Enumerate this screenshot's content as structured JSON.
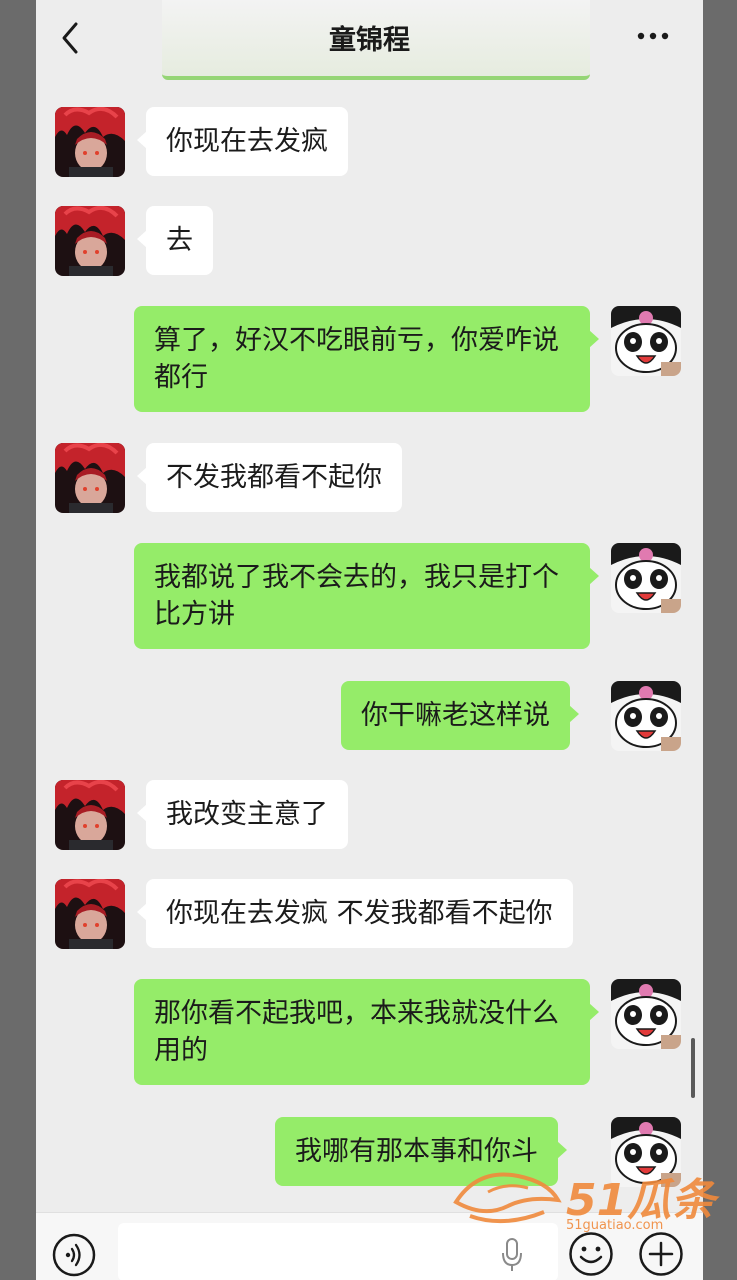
{
  "header": {
    "title": "童锦程",
    "back_icon": "chevron-left-icon",
    "more_icon": "more-dots-icon"
  },
  "colors": {
    "my_bubble": "#95ec69",
    "their_bubble": "#ffffff",
    "background": "#ededed",
    "watermark": "#f08a3c"
  },
  "messages": [
    {
      "sender": "other",
      "text": "你现在去发疯"
    },
    {
      "sender": "other",
      "text": "去"
    },
    {
      "sender": "me",
      "text": "算了，好汉不吃眼前亏，你爱咋说都行"
    },
    {
      "sender": "other",
      "text": "不发我都看不起你"
    },
    {
      "sender": "me",
      "text": "我都说了我不会去的，我只是打个比方讲"
    },
    {
      "sender": "me",
      "text": "你干嘛老这样说"
    },
    {
      "sender": "other",
      "text": "我改变主意了"
    },
    {
      "sender": "other",
      "text": "你现在去发疯 不发我都看不起你"
    },
    {
      "sender": "me",
      "text": "那你看不起我吧，本来我就没什么用的"
    },
    {
      "sender": "me",
      "text": "我哪有那本事和你斗"
    }
  ],
  "input_bar": {
    "text_value": "",
    "voice_icon": "voice-wave-icon",
    "mic_icon": "microphone-icon",
    "emoji_icon": "smiley-icon",
    "plus_icon": "plus-icon"
  },
  "watermark": {
    "brand": "51瓜条",
    "domain": "51guatiao.com"
  }
}
